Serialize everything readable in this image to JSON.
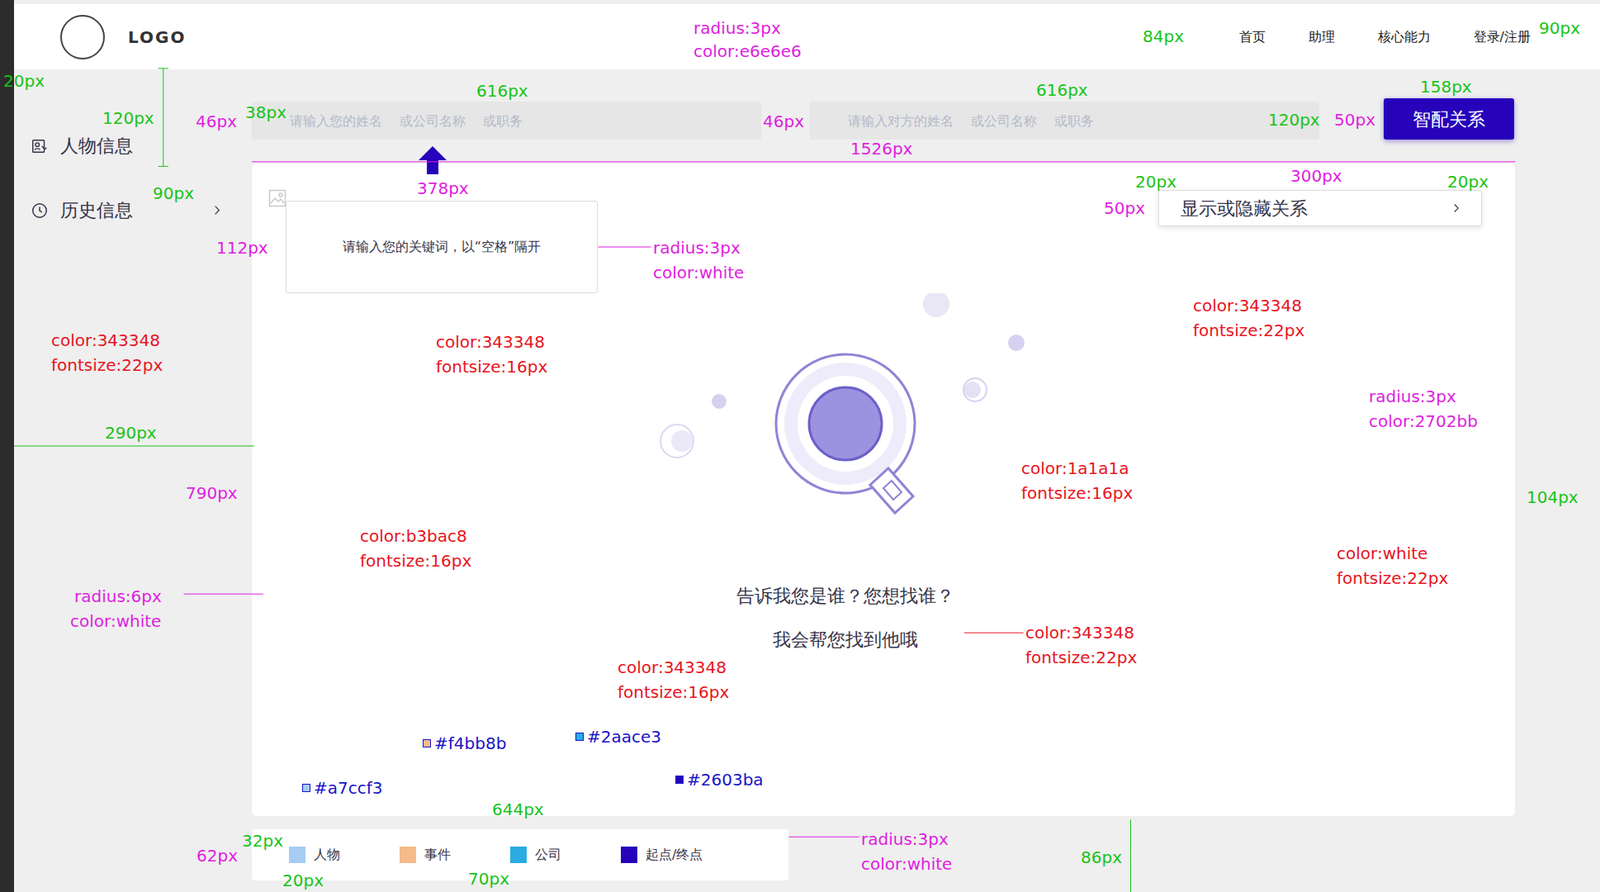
{
  "header": {
    "logo": "LOGO",
    "nav": [
      "首页",
      "助理",
      "核心能力",
      "登录/注册"
    ]
  },
  "sidebar": {
    "items": [
      {
        "label": "人物信息",
        "kind": "plain"
      },
      {
        "label": "历史信息",
        "kind": "submenu"
      }
    ]
  },
  "search": {
    "self_placeholder": "请输入您的姓名　 或公司名称　 或职务",
    "other_placeholder": "请输入对方的姓名　 或公司名称　 或职务",
    "button": "智配关系"
  },
  "keyword": {
    "text": "请输入您的关键词，以“空格”隔开"
  },
  "toggle": {
    "label": "显示或隐藏关系"
  },
  "empty_state": {
    "title": "告诉我您是谁？您想找谁？",
    "subtitle": "我会帮您找到他哦"
  },
  "legend": [
    {
      "label": "人物",
      "color": "#a7ccf3"
    },
    {
      "label": "事件",
      "color": "#f4bb8b"
    },
    {
      "label": "公司",
      "color": "#2aace3"
    },
    {
      "label": "起点/终点",
      "color": "#2603ba"
    }
  ],
  "annotations": [
    {
      "text": "radius:3px",
      "kind": "spec"
    },
    {
      "text": "color:e6e6e6",
      "kind": "spec"
    },
    {
      "text": "84px",
      "kind": "dimension"
    },
    {
      "text": "90px",
      "kind": "dimension"
    },
    {
      "text": "20px",
      "kind": "dimension"
    },
    {
      "text": "616px",
      "kind": "dimension"
    },
    {
      "text": "616px",
      "kind": "dimension"
    },
    {
      "text": "158px",
      "kind": "dimension"
    },
    {
      "text": "38px",
      "kind": "dimension"
    },
    {
      "text": "46px",
      "kind": "spec"
    },
    {
      "text": "46px",
      "kind": "spec"
    },
    {
      "text": "120px",
      "kind": "dimension"
    },
    {
      "text": "120px",
      "kind": "dimension"
    },
    {
      "text": "50px",
      "kind": "spec"
    },
    {
      "text": "1526px",
      "kind": "spec"
    },
    {
      "text": "90px",
      "kind": "dimension"
    },
    {
      "text": "378px",
      "kind": "spec"
    },
    {
      "text": "300px",
      "kind": "spec"
    },
    {
      "text": "20px",
      "kind": "dimension"
    },
    {
      "text": "20px",
      "kind": "dimension"
    },
    {
      "text": "50px",
      "kind": "spec"
    },
    {
      "text": "112px",
      "kind": "spec"
    },
    {
      "text": "radius:3px",
      "kind": "spec"
    },
    {
      "text": "color:white",
      "kind": "spec"
    },
    {
      "text": "color:343348",
      "kind": "font"
    },
    {
      "text": "fontsize:22px",
      "kind": "font"
    },
    {
      "text": "color:343348",
      "kind": "font"
    },
    {
      "text": "fontsize:16px",
      "kind": "font"
    },
    {
      "text": "color:343348",
      "kind": "font"
    },
    {
      "text": "fontsize:22px",
      "kind": "font"
    },
    {
      "text": "radius:3px",
      "kind": "spec"
    },
    {
      "text": "color:2702bb",
      "kind": "spec"
    },
    {
      "text": "290px",
      "kind": "dimension"
    },
    {
      "text": "790px",
      "kind": "spec"
    },
    {
      "text": "104px",
      "kind": "dimension"
    },
    {
      "text": "color:1a1a1a",
      "kind": "font"
    },
    {
      "text": "fontsize:16px",
      "kind": "font"
    },
    {
      "text": "color:b3bac8",
      "kind": "font"
    },
    {
      "text": "fontsize:16px",
      "kind": "font"
    },
    {
      "text": "color:white",
      "kind": "font"
    },
    {
      "text": "fontsize:22px",
      "kind": "font"
    },
    {
      "text": "radius:6px",
      "kind": "spec"
    },
    {
      "text": "color:white",
      "kind": "spec"
    },
    {
      "text": "color:343348",
      "kind": "font"
    },
    {
      "text": "fontsize:22px",
      "kind": "font"
    },
    {
      "text": "color:343348",
      "kind": "font"
    },
    {
      "text": "fontsize:16px",
      "kind": "font"
    },
    {
      "text": "#f4bb8b",
      "kind": "swatch",
      "color": "#f4bb8b"
    },
    {
      "text": "#2aace3",
      "kind": "swatch",
      "color": "#2aace3"
    },
    {
      "text": "#a7ccf3",
      "kind": "swatch",
      "color": "#a7ccf3"
    },
    {
      "text": "#2603ba",
      "kind": "swatch",
      "color": "#2603ba"
    },
    {
      "text": "644px",
      "kind": "dimension"
    },
    {
      "text": "32px",
      "kind": "dimension"
    },
    {
      "text": "62px",
      "kind": "spec"
    },
    {
      "text": "20px",
      "kind": "dimension"
    },
    {
      "text": "70px",
      "kind": "dimension"
    },
    {
      "text": "radius:3px",
      "kind": "spec"
    },
    {
      "text": "color:white",
      "kind": "spec"
    },
    {
      "text": "86px",
      "kind": "dimension"
    }
  ]
}
